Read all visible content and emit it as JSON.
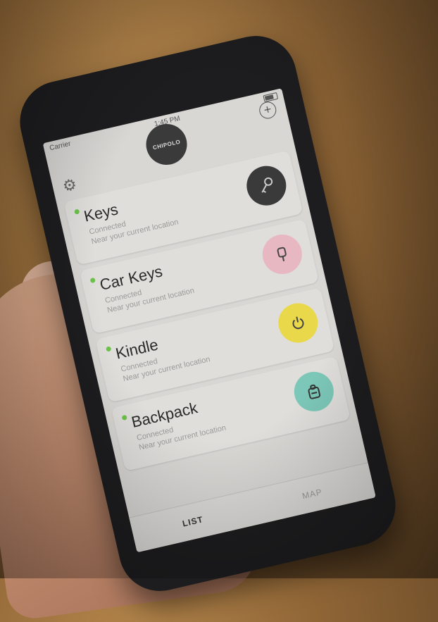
{
  "status": {
    "carrier": "Carrier",
    "time": "1:45 PM"
  },
  "app": {
    "logo_text": "CHIPOLO"
  },
  "items": [
    {
      "name": "Keys",
      "status": "Connected",
      "location": "Near your current location",
      "badge_color": "#3a3a3a",
      "icon": "key-icon"
    },
    {
      "name": "Car Keys",
      "status": "Connected",
      "location": "Near your current location",
      "badge_color": "#e8b8c2",
      "icon": "car-key-icon"
    },
    {
      "name": "Kindle",
      "status": "Connected",
      "location": "Near your current location",
      "badge_color": "#e8d84a",
      "icon": "power-icon"
    },
    {
      "name": "Backpack",
      "status": "Connected",
      "location": "Near your current location",
      "badge_color": "#7cc7b8",
      "icon": "backpack-icon"
    }
  ],
  "tabs": [
    {
      "label": "LIST",
      "active": true
    },
    {
      "label": "MAP",
      "active": false
    }
  ]
}
